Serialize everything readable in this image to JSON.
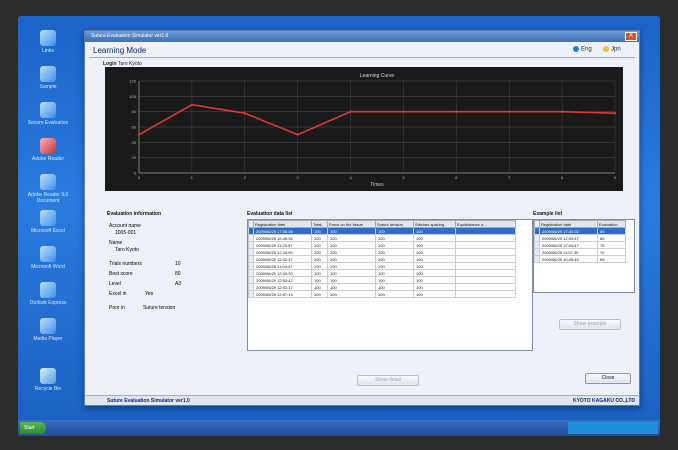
{
  "window": {
    "title": "Sutura Evaluation Simulator ver1.0",
    "mode": "Learning Mode",
    "close_glyph": "X",
    "status_app": "Suture Evaluation Simulator ver1.0",
    "status_company": "KYOTO KAGAKU CO.,LTD"
  },
  "languages": [
    {
      "label": "Eng",
      "color": "#1f7fe0"
    },
    {
      "label": "Jpn",
      "color": "#f2c230"
    }
  ],
  "login": {
    "label": "Login",
    "value": "Taro Kyoto"
  },
  "chart_data": {
    "type": "line",
    "title": "Learning Curve",
    "xlabel": "Times",
    "ylabel": "",
    "x": [
      0,
      1,
      2,
      3,
      4,
      5,
      6,
      7,
      8,
      9
    ],
    "series": [
      {
        "values": [
          50,
          89,
          78,
          50,
          80,
          80,
          80,
          80,
          80,
          78
        ],
        "color": "#d93a3a"
      }
    ],
    "ylim": [
      0,
      120
    ],
    "xlim": [
      0,
      9
    ],
    "yticks": [
      0,
      20,
      40,
      60,
      80,
      100,
      120
    ],
    "grid": true
  },
  "evaluation_info": {
    "title": "Evaluation information",
    "account_label": "Account name",
    "account_value": "1005-001",
    "name_label": "Name",
    "name_value": "Taro Kyoto",
    "trials_label": "Trials numbers",
    "trials_value": "10",
    "best_label": "Best score",
    "best_value": "80",
    "level_label": "Level",
    "level_value": "A3",
    "excel_label": "Excel in",
    "excel_value": "Yes",
    "poor_label": "Poor in",
    "poor_value": "Suture tension"
  },
  "eval_list": {
    "title": "Evaluation data list",
    "columns": [
      "Registration date",
      "Total",
      "Force on the tissue",
      "Suture tension",
      "Stitches spacing",
      "Equidistance o..."
    ],
    "rows": [
      [
        "2009/06/29 17:55:06",
        "100",
        "100",
        "100",
        "100",
        ""
      ],
      [
        "2009/06/29 16:45:36",
        "100",
        "100",
        "100",
        "100",
        ""
      ],
      [
        "2009/06/29 11:25:57",
        "100",
        "100",
        "100",
        "100",
        ""
      ],
      [
        "2009/06/29 12:44:50",
        "100",
        "100",
        "100",
        "100",
        ""
      ],
      [
        "2009/06/29 12:02:47",
        "100",
        "100",
        "100",
        "100",
        ""
      ],
      [
        "2009/06/29 11:04:47",
        "100",
        "100",
        "100",
        "100",
        ""
      ],
      [
        "2009/06/29 12:04:30",
        "100",
        "100",
        "100",
        "100",
        ""
      ],
      [
        "2009/06/29 12:03:42",
        "100",
        "100",
        "100",
        "100",
        ""
      ],
      [
        "2009/06/29 12:01:17",
        "100",
        "100",
        "100",
        "100",
        ""
      ],
      [
        "2009/06/29 12:07:14",
        "100",
        "100",
        "100",
        "100",
        ""
      ]
    ],
    "button": "Show detail"
  },
  "example_list": {
    "title": "Example list",
    "columns": [
      "Registration date",
      "Evaluation"
    ],
    "rows": [
      [
        "2009/06/29 17:40:02",
        "85"
      ],
      [
        "2009/06/29 12:53:47",
        "80"
      ],
      [
        "2009/06/29 12:04:47",
        "75"
      ],
      [
        "2009/06/29 11:57:30",
        "70"
      ],
      [
        "2009/06/29 10:45:46",
        "65"
      ]
    ],
    "button": "Show example"
  },
  "close_button": "Close",
  "desktop_icons": [
    "Links",
    "Sample",
    "Secure Evaluation",
    "Adobe Reader",
    "Adobe Reader 9.0 Document",
    "Microsoft Excel",
    "Microsoft Word",
    "Outlook Express",
    "Media Player",
    "Recycle Bin"
  ],
  "taskbar": {
    "start": "Start"
  }
}
